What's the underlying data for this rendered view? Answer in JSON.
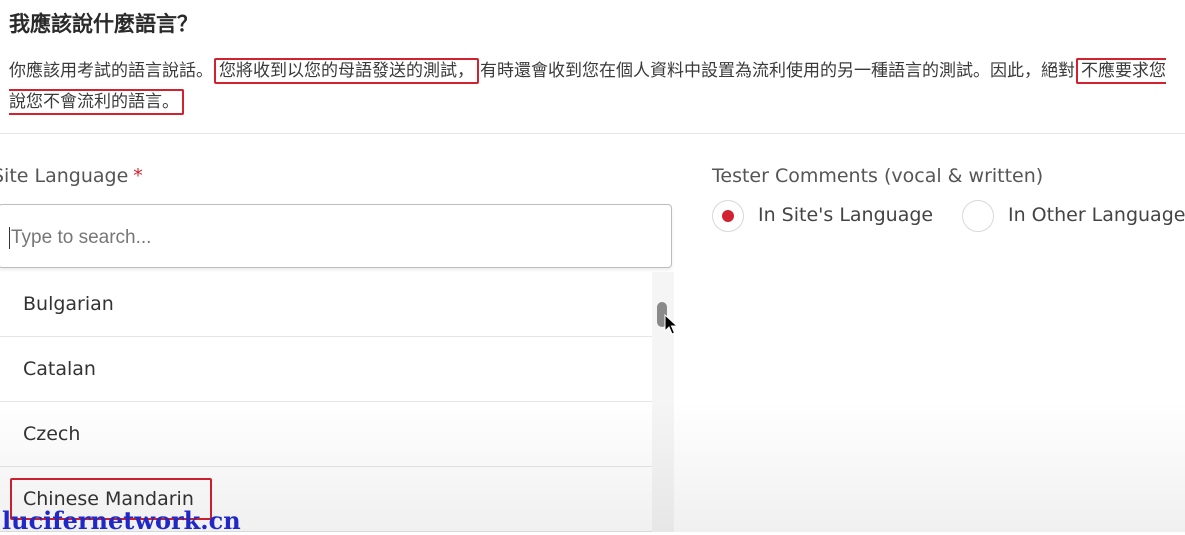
{
  "heading": "我應該說什麼語言？",
  "paragraph": {
    "part1": "你應該用考試的語言說話。",
    "highlight1": "您將收到以您的母語發送的測試，",
    "part2": "有時還會收到您在個人資料中設置為流利使用的另一種語言的測試。因此，絕對",
    "highlight2": "不應要求您說您不會流利的語言。"
  },
  "site_language": {
    "label": "Site Language",
    "required_mark": "*",
    "search_placeholder": "Type to search...",
    "options": [
      "Bulgarian",
      "Catalan",
      "Czech",
      "Chinese Mandarin"
    ]
  },
  "tester_comments": {
    "label": "Tester Comments (vocal & written)",
    "option_site": "In Site's Language",
    "option_other": "In Other Language",
    "selected": "In Site's Language"
  },
  "watermark": "lucifernetwork.cn",
  "colors": {
    "accent": "#d2212f",
    "watermark": "#2029c8"
  }
}
